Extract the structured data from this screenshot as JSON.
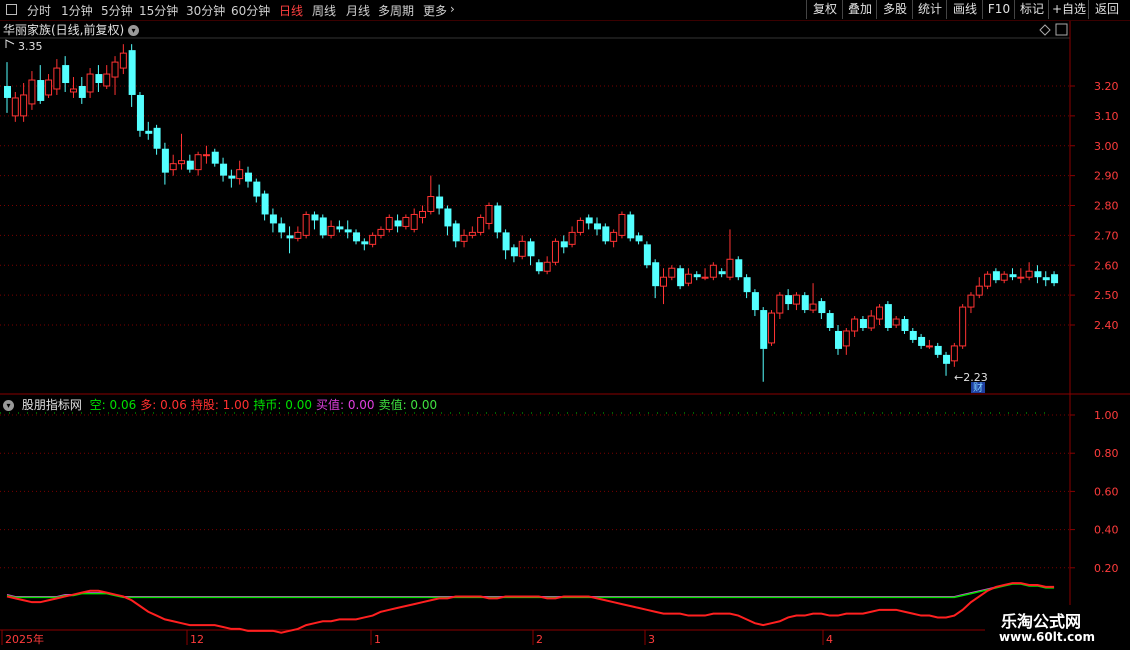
{
  "toolbar": {
    "tabs": [
      "分时",
      "1分钟",
      "5分钟",
      "15分钟",
      "30分钟",
      "60分钟",
      "日线",
      "周线",
      "月线",
      "多周期",
      "更多"
    ],
    "active_tab": "日线",
    "more_chevron": "chevron-right-icon",
    "right_buttons": [
      "复权",
      "叠加",
      "多股",
      "统计",
      "画线",
      "F10",
      "标记",
      "+自选",
      "返回"
    ]
  },
  "main_chart": {
    "title": "华丽家族(日线,前复权)",
    "high_label": "3.35",
    "low_label": "←2.23",
    "finance_badge": "财",
    "price_ticks": [
      "3.20",
      "3.10",
      "3.00",
      "2.90",
      "2.80",
      "2.70",
      "2.60",
      "2.50",
      "2.40"
    ]
  },
  "indicator": {
    "name": "股朋指标网",
    "items": [
      {
        "label": "空: ",
        "value": "0.06",
        "color": "#00e000"
      },
      {
        "label": "多: ",
        "value": "0.06",
        "color": "#ff3030"
      },
      {
        "label": "持股: ",
        "value": "1.00",
        "color": "#ff3030"
      },
      {
        "label": "持币: ",
        "value": "0.00",
        "color": "#00e000"
      },
      {
        "label": "买值: ",
        "value": "0.00",
        "color": "#e040e0"
      },
      {
        "label": "卖值: ",
        "value": "0.00",
        "color": "#40e040"
      }
    ],
    "ticks": [
      "1.00",
      "0.80",
      "0.60",
      "0.40",
      "0.20"
    ]
  },
  "date_axis": {
    "labels": [
      "2025年",
      "12",
      "1",
      "2",
      "3",
      "4"
    ]
  },
  "watermark": {
    "title": "乐淘公式网",
    "url": "www.60lt.com"
  },
  "colors": {
    "up": "#ff3333",
    "down": "#54ffff",
    "grid": "#7a0000",
    "axis_text": "#ff3c3c",
    "accent": "#ff4040"
  },
  "chart_data": {
    "type": "candlestick",
    "title": "华丽家族(日线,前复权)",
    "ylim": [
      2.18,
      3.4
    ],
    "price_ticks": [
      3.2,
      3.1,
      3.0,
      2.9,
      2.8,
      2.7,
      2.6,
      2.5,
      2.4
    ],
    "high": 3.35,
    "low": 2.23,
    "date_labels": [
      "2025年",
      "12",
      "1",
      "2",
      "3",
      "4"
    ],
    "candles": [
      [
        3.2,
        3.16,
        3.28,
        3.11
      ],
      [
        3.1,
        3.16,
        3.18,
        3.08
      ],
      [
        3.1,
        3.17,
        3.21,
        3.08
      ],
      [
        3.14,
        3.22,
        3.25,
        3.12
      ],
      [
        3.22,
        3.15,
        3.27,
        3.14
      ],
      [
        3.17,
        3.22,
        3.24,
        3.16
      ],
      [
        3.19,
        3.26,
        3.29,
        3.17
      ],
      [
        3.27,
        3.21,
        3.3,
        3.18
      ],
      [
        3.18,
        3.19,
        3.23,
        3.16
      ],
      [
        3.2,
        3.16,
        3.23,
        3.14
      ],
      [
        3.18,
        3.24,
        3.26,
        3.16
      ],
      [
        3.24,
        3.21,
        3.27,
        3.18
      ],
      [
        3.2,
        3.24,
        3.27,
        3.19
      ],
      [
        3.23,
        3.28,
        3.3,
        3.17
      ],
      [
        3.26,
        3.31,
        3.34,
        3.24
      ],
      [
        3.32,
        3.17,
        3.34,
        3.13
      ],
      [
        3.17,
        3.05,
        3.18,
        3.03
      ],
      [
        3.05,
        3.04,
        3.08,
        3.02
      ],
      [
        3.06,
        2.99,
        3.07,
        2.97
      ],
      [
        2.99,
        2.91,
        3.01,
        2.87
      ],
      [
        2.92,
        2.94,
        2.97,
        2.9
      ],
      [
        2.94,
        2.95,
        3.04,
        2.92
      ],
      [
        2.95,
        2.92,
        2.97,
        2.91
      ],
      [
        2.92,
        2.97,
        2.98,
        2.9
      ],
      [
        2.97,
        2.97,
        3.0,
        2.94
      ],
      [
        2.98,
        2.94,
        2.99,
        2.93
      ],
      [
        2.94,
        2.9,
        2.96,
        2.88
      ],
      [
        2.9,
        2.89,
        2.92,
        2.86
      ],
      [
        2.89,
        2.92,
        2.95,
        2.87
      ],
      [
        2.91,
        2.88,
        2.93,
        2.86
      ],
      [
        2.88,
        2.83,
        2.89,
        2.81
      ],
      [
        2.84,
        2.77,
        2.85,
        2.75
      ],
      [
        2.77,
        2.74,
        2.79,
        2.71
      ],
      [
        2.74,
        2.71,
        2.76,
        2.69
      ],
      [
        2.7,
        2.69,
        2.73,
        2.64
      ],
      [
        2.69,
        2.71,
        2.73,
        2.68
      ],
      [
        2.7,
        2.77,
        2.78,
        2.69
      ],
      [
        2.77,
        2.75,
        2.78,
        2.72
      ],
      [
        2.76,
        2.7,
        2.77,
        2.69
      ],
      [
        2.7,
        2.73,
        2.75,
        2.69
      ],
      [
        2.73,
        2.72,
        2.75,
        2.71
      ],
      [
        2.72,
        2.71,
        2.75,
        2.69
      ],
      [
        2.71,
        2.68,
        2.72,
        2.67
      ],
      [
        2.68,
        2.67,
        2.69,
        2.65
      ],
      [
        2.67,
        2.7,
        2.71,
        2.66
      ],
      [
        2.7,
        2.72,
        2.73,
        2.69
      ],
      [
        2.72,
        2.76,
        2.77,
        2.71
      ],
      [
        2.75,
        2.73,
        2.77,
        2.71
      ],
      [
        2.73,
        2.76,
        2.77,
        2.72
      ],
      [
        2.72,
        2.77,
        2.79,
        2.71
      ],
      [
        2.76,
        2.78,
        2.8,
        2.74
      ],
      [
        2.78,
        2.83,
        2.9,
        2.77
      ],
      [
        2.83,
        2.79,
        2.87,
        2.77
      ],
      [
        2.79,
        2.73,
        2.8,
        2.7
      ],
      [
        2.74,
        2.68,
        2.75,
        2.66
      ],
      [
        2.68,
        2.7,
        2.72,
        2.66
      ],
      [
        2.7,
        2.71,
        2.73,
        2.69
      ],
      [
        2.71,
        2.76,
        2.77,
        2.7
      ],
      [
        2.74,
        2.8,
        2.81,
        2.72
      ],
      [
        2.8,
        2.71,
        2.81,
        2.69
      ],
      [
        2.71,
        2.65,
        2.72,
        2.62
      ],
      [
        2.66,
        2.63,
        2.67,
        2.61
      ],
      [
        2.63,
        2.68,
        2.7,
        2.62
      ],
      [
        2.68,
        2.63,
        2.69,
        2.6
      ],
      [
        2.61,
        2.58,
        2.62,
        2.57
      ],
      [
        2.58,
        2.61,
        2.63,
        2.57
      ],
      [
        2.61,
        2.68,
        2.69,
        2.6
      ],
      [
        2.68,
        2.66,
        2.7,
        2.64
      ],
      [
        2.67,
        2.71,
        2.73,
        2.66
      ],
      [
        2.71,
        2.75,
        2.76,
        2.7
      ],
      [
        2.76,
        2.74,
        2.77,
        2.72
      ],
      [
        2.74,
        2.72,
        2.76,
        2.7
      ],
      [
        2.73,
        2.68,
        2.74,
        2.67
      ],
      [
        2.68,
        2.71,
        2.72,
        2.66
      ],
      [
        2.7,
        2.77,
        2.78,
        2.69
      ],
      [
        2.77,
        2.69,
        2.78,
        2.68
      ],
      [
        2.7,
        2.68,
        2.71,
        2.67
      ],
      [
        2.67,
        2.6,
        2.68,
        2.59
      ],
      [
        2.61,
        2.53,
        2.62,
        2.49
      ],
      [
        2.53,
        2.56,
        2.59,
        2.47
      ],
      [
        2.56,
        2.59,
        2.6,
        2.55
      ],
      [
        2.59,
        2.53,
        2.6,
        2.52
      ],
      [
        2.54,
        2.57,
        2.59,
        2.53
      ],
      [
        2.57,
        2.56,
        2.58,
        2.55
      ],
      [
        2.56,
        2.56,
        2.59,
        2.55
      ],
      [
        2.56,
        2.6,
        2.61,
        2.55
      ],
      [
        2.58,
        2.57,
        2.59,
        2.56
      ],
      [
        2.56,
        2.62,
        2.72,
        2.55
      ],
      [
        2.62,
        2.56,
        2.63,
        2.55
      ],
      [
        2.56,
        2.51,
        2.57,
        2.49
      ],
      [
        2.51,
        2.45,
        2.52,
        2.43
      ],
      [
        2.45,
        2.32,
        2.46,
        2.21
      ],
      [
        2.34,
        2.44,
        2.45,
        2.33
      ],
      [
        2.44,
        2.5,
        2.51,
        2.42
      ],
      [
        2.5,
        2.47,
        2.52,
        2.45
      ],
      [
        2.47,
        2.5,
        2.51,
        2.45
      ],
      [
        2.5,
        2.45,
        2.51,
        2.44
      ],
      [
        2.45,
        2.47,
        2.54,
        2.44
      ],
      [
        2.48,
        2.44,
        2.49,
        2.42
      ],
      [
        2.44,
        2.39,
        2.45,
        2.38
      ],
      [
        2.38,
        2.32,
        2.4,
        2.3
      ],
      [
        2.33,
        2.38,
        2.39,
        2.3
      ],
      [
        2.38,
        2.42,
        2.43,
        2.36
      ],
      [
        2.42,
        2.39,
        2.43,
        2.38
      ],
      [
        2.39,
        2.43,
        2.45,
        2.38
      ],
      [
        2.42,
        2.46,
        2.47,
        2.4
      ],
      [
        2.47,
        2.39,
        2.48,
        2.38
      ],
      [
        2.4,
        2.42,
        2.43,
        2.39
      ],
      [
        2.42,
        2.38,
        2.43,
        2.37
      ],
      [
        2.38,
        2.35,
        2.39,
        2.34
      ],
      [
        2.36,
        2.33,
        2.37,
        2.32
      ],
      [
        2.33,
        2.33,
        2.35,
        2.32
      ],
      [
        2.33,
        2.3,
        2.34,
        2.29
      ],
      [
        2.3,
        2.27,
        2.31,
        2.23
      ],
      [
        2.28,
        2.33,
        2.34,
        2.26
      ],
      [
        2.33,
        2.46,
        2.47,
        2.32
      ],
      [
        2.46,
        2.5,
        2.51,
        2.44
      ],
      [
        2.5,
        2.53,
        2.56,
        2.49
      ],
      [
        2.53,
        2.57,
        2.58,
        2.52
      ],
      [
        2.58,
        2.55,
        2.59,
        2.54
      ],
      [
        2.55,
        2.57,
        2.58,
        2.54
      ],
      [
        2.57,
        2.56,
        2.59,
        2.55
      ],
      [
        2.56,
        2.56,
        2.59,
        2.54
      ],
      [
        2.56,
        2.58,
        2.61,
        2.55
      ],
      [
        2.58,
        2.56,
        2.6,
        2.54
      ],
      [
        2.56,
        2.55,
        2.58,
        2.53
      ],
      [
        2.57,
        2.54,
        2.58,
        2.53
      ]
    ],
    "indicator": {
      "name": "股朋指标网",
      "ylim": [
        0,
        1.05
      ],
      "ticks": [
        1.0,
        0.8,
        0.6,
        0.4,
        0.2
      ],
      "last": {
        "空": 0.06,
        "多": 0.06,
        "持股": 1.0,
        "持币": 0.0,
        "买值": 0.0,
        "卖值": 0.0
      },
      "red_line": [
        0.05,
        0.04,
        0.03,
        0.02,
        0.02,
        0.03,
        0.04,
        0.05,
        0.06,
        0.07,
        0.08,
        0.08,
        0.07,
        0.06,
        0.05,
        0.03,
        0.0,
        -0.03,
        -0.05,
        -0.07,
        -0.08,
        -0.09,
        -0.1,
        -0.1,
        -0.1,
        -0.1,
        -0.11,
        -0.12,
        -0.12,
        -0.13,
        -0.13,
        -0.13,
        -0.13,
        -0.14,
        -0.13,
        -0.12,
        -0.1,
        -0.09,
        -0.08,
        -0.08,
        -0.07,
        -0.07,
        -0.07,
        -0.06,
        -0.05,
        -0.03,
        -0.02,
        -0.01,
        0.0,
        0.01,
        0.02,
        0.03,
        0.04,
        0.04,
        0.05,
        0.05,
        0.05,
        0.05,
        0.04,
        0.04,
        0.05,
        0.05,
        0.05,
        0.05,
        0.05,
        0.04,
        0.04,
        0.05,
        0.05,
        0.05,
        0.05,
        0.04,
        0.03,
        0.02,
        0.01,
        0.0,
        -0.01,
        -0.02,
        -0.03,
        -0.04,
        -0.04,
        -0.04,
        -0.05,
        -0.05,
        -0.05,
        -0.04,
        -0.04,
        -0.04,
        -0.05,
        -0.07,
        -0.09,
        -0.1,
        -0.09,
        -0.08,
        -0.06,
        -0.05,
        -0.05,
        -0.04,
        -0.04,
        -0.05,
        -0.05,
        -0.04,
        -0.04,
        -0.04,
        -0.03,
        -0.02,
        -0.02,
        -0.02,
        -0.03,
        -0.04,
        -0.05,
        -0.05,
        -0.06,
        -0.06,
        -0.05,
        -0.02,
        0.02,
        0.05,
        0.08,
        0.1,
        0.11,
        0.12,
        0.12,
        0.11,
        0.11,
        0.1,
        0.1
      ],
      "green_line": [
        0.06,
        0.05,
        0.05,
        0.05,
        0.05,
        0.05,
        0.05,
        0.06,
        0.06,
        0.07,
        0.07,
        0.07,
        0.07,
        0.06,
        0.05,
        0.05,
        0.05,
        0.05,
        0.05,
        0.05,
        0.05,
        0.05,
        0.05,
        0.05,
        0.05,
        0.05,
        0.05,
        0.05,
        0.05,
        0.05,
        0.05,
        0.05,
        0.05,
        0.05,
        0.05,
        0.05,
        0.05,
        0.05,
        0.05,
        0.05,
        0.05,
        0.05,
        0.05,
        0.05,
        0.05,
        0.05,
        0.05,
        0.05,
        0.05,
        0.05,
        0.05,
        0.05,
        0.05,
        0.05,
        0.05,
        0.05,
        0.05,
        0.05,
        0.05,
        0.05,
        0.05,
        0.05,
        0.05,
        0.05,
        0.05,
        0.05,
        0.05,
        0.05,
        0.05,
        0.05,
        0.05,
        0.05,
        0.05,
        0.05,
        0.05,
        0.05,
        0.05,
        0.05,
        0.05,
        0.05,
        0.05,
        0.05,
        0.05,
        0.05,
        0.05,
        0.05,
        0.05,
        0.05,
        0.05,
        0.05,
        0.05,
        0.05,
        0.05,
        0.05,
        0.05,
        0.05,
        0.05,
        0.05,
        0.05,
        0.05,
        0.05,
        0.05,
        0.05,
        0.05,
        0.05,
        0.05,
        0.05,
        0.05,
        0.05,
        0.05,
        0.05,
        0.05,
        0.05,
        0.05,
        0.05,
        0.06,
        0.07,
        0.08,
        0.09,
        0.1,
        0.11,
        0.12,
        0.12,
        0.11,
        0.11,
        0.1,
        0.1
      ]
    }
  }
}
